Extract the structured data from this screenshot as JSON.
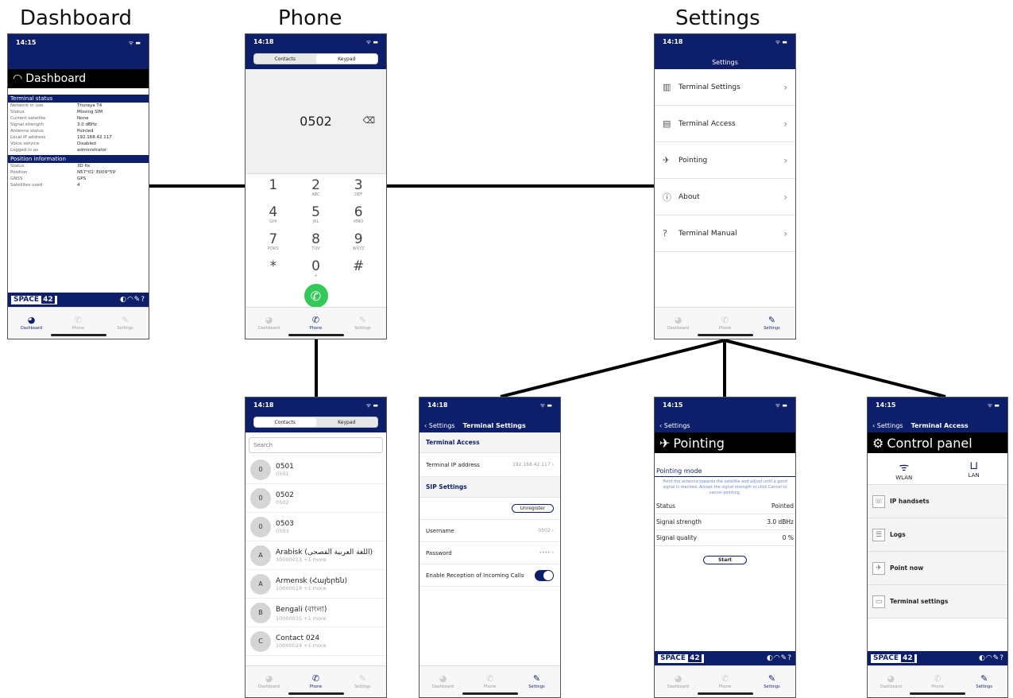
{
  "titles": {
    "dashboard": "Dashboard",
    "phone": "Phone",
    "settings": "Settings"
  },
  "status_time": "14:15",
  "status_time_b": "14:18",
  "tabs": {
    "dashboard": "Dashboard",
    "phone": "Phone",
    "settings": "Settings"
  },
  "brand": {
    "left": "SPACE",
    "right": "42"
  },
  "dashboard": {
    "header": "Dashboard",
    "terminal_status": "Terminal status",
    "rows": [
      {
        "k": "Network in use",
        "v": "Thuraya T4"
      },
      {
        "k": "Status",
        "v": "Missing SIM"
      },
      {
        "k": "Current satellite",
        "v": "None"
      },
      {
        "k": "Signal strength",
        "v": "3.0 dBHz"
      },
      {
        "k": "Antenna status",
        "v": "Pointed"
      },
      {
        "k": "Local IP address",
        "v": "192.168.42.117"
      },
      {
        "k": "Voice service",
        "v": "Disabled"
      },
      {
        "k": "Logged in as",
        "v": "administrator"
      }
    ],
    "position_info": "Position information",
    "pos_rows": [
      {
        "k": "Status",
        "v": "3D fix"
      },
      {
        "k": "Position",
        "v": "N57°01' E009°59'"
      },
      {
        "k": "GNSS",
        "v": "GPS"
      },
      {
        "k": "Satellites used",
        "v": "4"
      }
    ]
  },
  "keypad": {
    "seg_contacts": "Contacts",
    "seg_keypad": "Keypad",
    "number": "0502",
    "keys": [
      {
        "d": "1",
        "l": ""
      },
      {
        "d": "2",
        "l": "ABC"
      },
      {
        "d": "3",
        "l": "DEF"
      },
      {
        "d": "4",
        "l": "GHI"
      },
      {
        "d": "5",
        "l": "JKL"
      },
      {
        "d": "6",
        "l": "MNO"
      },
      {
        "d": "7",
        "l": "PQRS"
      },
      {
        "d": "8",
        "l": "TUV"
      },
      {
        "d": "9",
        "l": "WXYZ"
      },
      {
        "d": "*",
        "l": ""
      },
      {
        "d": "0",
        "l": "+"
      },
      {
        "d": "#",
        "l": ""
      }
    ]
  },
  "settings": {
    "header": "Settings",
    "items": [
      "Terminal Settings",
      "Terminal Access",
      "Pointing",
      "About",
      "Terminal Manual"
    ]
  },
  "contacts": {
    "search_placeholder": "Search",
    "list": [
      {
        "a": "0",
        "n": "0501",
        "s": "0501"
      },
      {
        "a": "0",
        "n": "0502",
        "s": "0502"
      },
      {
        "a": "0",
        "n": "0503",
        "s": "0503"
      },
      {
        "a": "A",
        "n": "Arabisk (اللغة العربية الفصحى)",
        "s": "10000013 +1 more"
      },
      {
        "a": "A",
        "n": "Armensk (Հայերեն)",
        "s": "10000018 +1 more"
      },
      {
        "a": "B",
        "n": "Bengali (বাংলা)",
        "s": "10000015 +1 more"
      },
      {
        "a": "C",
        "n": "Contact 024",
        "s": "10000024 +1 more"
      }
    ]
  },
  "terminal_settings": {
    "back": "Settings",
    "title": "Terminal Settings",
    "access_head": "Terminal Access",
    "ip_label": "Terminal IP address",
    "ip_value": "192.168.42.117",
    "sip_head": "SIP Settings",
    "unregister": "Unregister",
    "username_label": "Username",
    "username_value": "0502",
    "password_label": "Password",
    "password_value": "••••",
    "incoming_label": "Enable Reception of Incoming Calls"
  },
  "pointing": {
    "back": "Settings",
    "title": "Pointing",
    "mode_head": "Pointing mode",
    "description": "Point the antenna towards the satellite and adjust until a good signal is reached. Accept the signal strength or click Cancel to cancel pointing.",
    "rows": [
      {
        "k": "Status",
        "v": "Pointed"
      },
      {
        "k": "Signal strength",
        "v": "3.0 dBHz"
      },
      {
        "k": "Signal quality",
        "v": "0 %"
      }
    ],
    "start": "Start"
  },
  "control_panel": {
    "back": "Settings",
    "nav_title": "Terminal Access",
    "title": "Control panel",
    "wlan": "WLAN",
    "lan": "LAN",
    "items": [
      "IP handsets",
      "Logs",
      "Point now",
      "Terminal settings"
    ]
  }
}
